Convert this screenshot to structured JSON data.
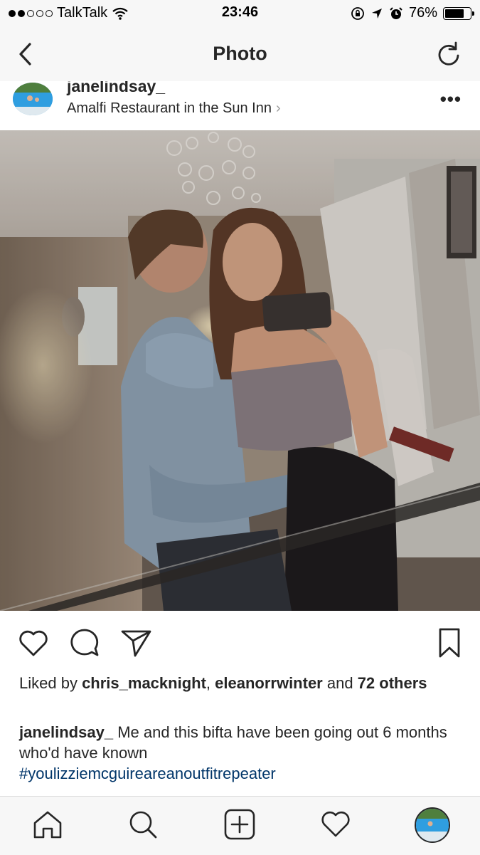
{
  "status_bar": {
    "carrier": "TalkTalk",
    "time": "23:46",
    "battery_percent_text": "76%",
    "battery_level": 0.76,
    "signal_bars_filled": 2,
    "signal_bars_total": 5
  },
  "nav": {
    "title": "Photo"
  },
  "post": {
    "username": "janelindsay_",
    "location": "Amalfi Restaurant in the Sun Inn",
    "location_chevron": "›",
    "more_label": "•••"
  },
  "likes": {
    "prefix": "Liked by ",
    "user1": "chris_macknight",
    "sep": ", ",
    "user2": "eleanorrwinter",
    "and": " and ",
    "others": "72 others"
  },
  "caption": {
    "username": "janelindsay_",
    "text": " Me and this bifta have been going out 6 months who'd have known",
    "hashtag": "#youlizziemcguireareanoutfitrepeater"
  },
  "icons": {
    "back": "chevron-left-icon",
    "refresh": "refresh-icon",
    "like": "heart-icon",
    "comment": "comment-icon",
    "share": "send-icon",
    "save": "bookmark-icon",
    "home": "home-icon",
    "search": "search-icon",
    "add": "add-post-icon",
    "activity": "heart-icon",
    "profile": "profile-avatar"
  },
  "colors": {
    "text": "#262626",
    "hashtag": "#003569",
    "bar_bg": "#f7f7f7"
  }
}
